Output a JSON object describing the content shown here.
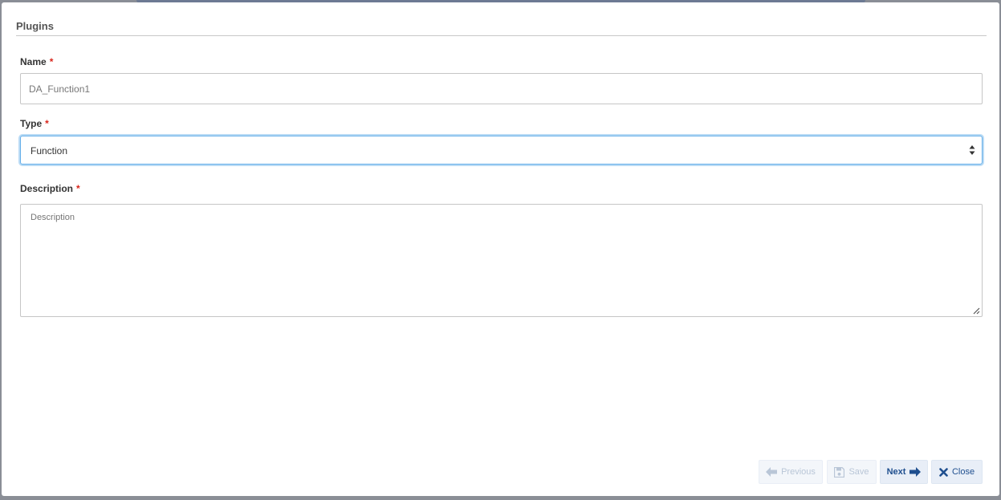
{
  "dialog": {
    "title": "Plugins"
  },
  "form": {
    "name": {
      "label": "Name",
      "required_mark": "*",
      "value": "DA_Function1"
    },
    "type": {
      "label": "Type",
      "required_mark": "*",
      "selected": "Function"
    },
    "description": {
      "label": "Description",
      "required_mark": "*",
      "placeholder": "Description",
      "value": ""
    }
  },
  "footer": {
    "previous_label": "Previous",
    "save_label": "Save",
    "next_label": "Next",
    "close_label": "Close"
  },
  "icons": {
    "previous": "arrow-left-icon",
    "save": "floppy-disk-icon",
    "next": "arrow-right-icon",
    "close": "x-icon",
    "select": "sort-updown-icon"
  },
  "colors": {
    "required": "#d9261c",
    "focus_border": "#66afe9",
    "button_text_active": "#1f4f8f",
    "button_text_disabled": "#b9c6d7"
  }
}
